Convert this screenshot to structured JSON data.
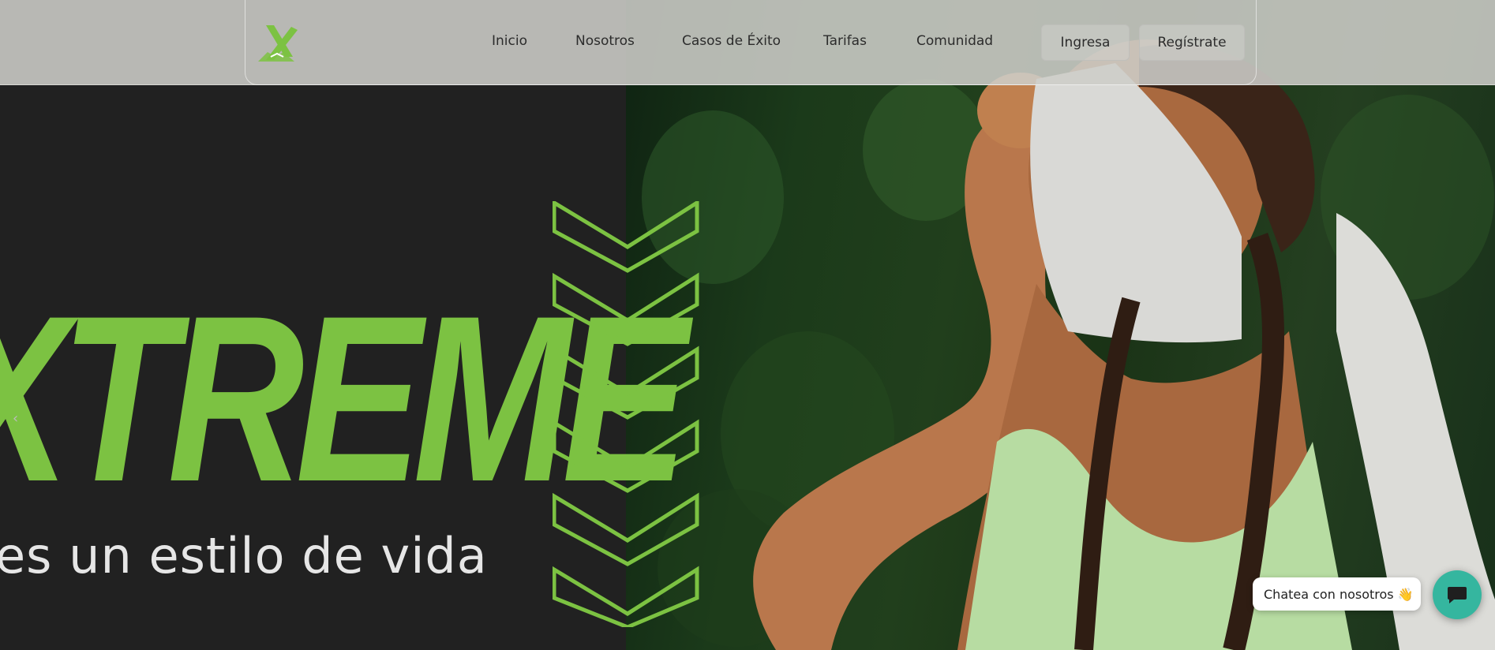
{
  "nav": {
    "links": [
      "Inicio",
      "Nosotros",
      "Casos de Éxito",
      "Tarifas",
      "Comunidad"
    ],
    "login_label": "Ingresa",
    "register_label": "Regístrate"
  },
  "hero": {
    "brand_word": "XTREME",
    "tagline": "es un estilo de vida",
    "prev_arrow": "‹"
  },
  "chat": {
    "bubble_text": "Chatea con nosotros 👋"
  },
  "colors": {
    "accent_green": "#7cc242",
    "chat_teal": "#35b69f",
    "dark_bg": "#212121"
  },
  "icons": {
    "logo": "x-logo-icon",
    "chevrons": "chevron-down-icon",
    "chat": "chat-icon"
  }
}
